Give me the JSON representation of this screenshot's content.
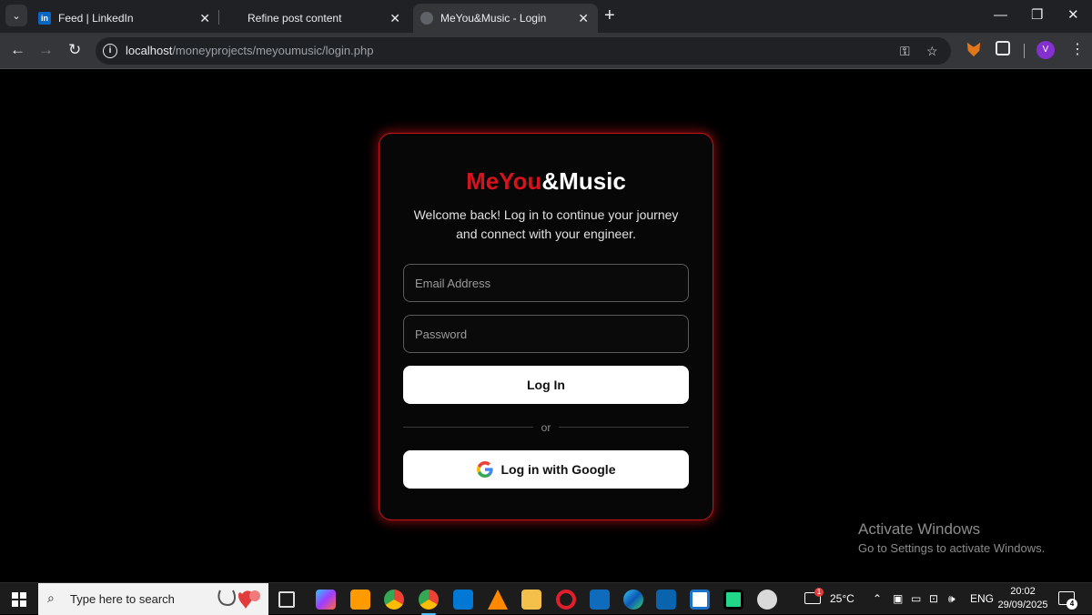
{
  "browser": {
    "tabs": [
      {
        "title": "Feed | LinkedIn",
        "favicon": "linkedin-icon"
      },
      {
        "title": "Refine post content",
        "favicon": "none"
      },
      {
        "title": "MeYou&Music - Login",
        "favicon": "globe-icon",
        "active": true
      }
    ],
    "url_host": "localhost",
    "url_path": "/moneyprojects/meyoumusic/login.php",
    "profile_initial": "V"
  },
  "app": {
    "logo_accent": "MeYou",
    "logo_rest": "&Music",
    "subtitle": "Welcome back! Log in to continue your journey and connect with your engineer.",
    "email_placeholder": "Email Address",
    "password_placeholder": "Password",
    "login_label": "Log In",
    "divider_text": "or",
    "google_label": "Log in with Google",
    "accent_color": "#d6131c"
  },
  "watermark": {
    "title": "Activate Windows",
    "subtitle": "Go to Settings to activate Windows."
  },
  "taskbar": {
    "search_placeholder": "Type here to search",
    "weather_badge": "1",
    "temperature": "25°C",
    "language": "ENG",
    "time": "20:02",
    "date": "29/09/2025",
    "notification_count": "4"
  }
}
